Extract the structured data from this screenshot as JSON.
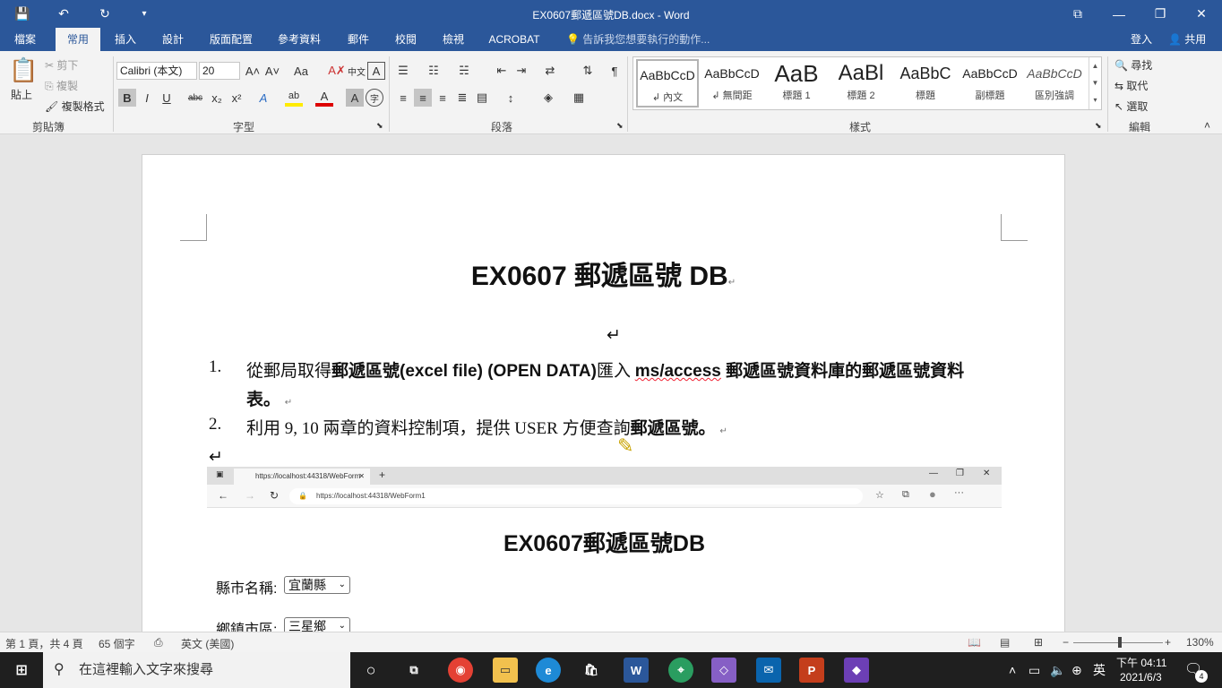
{
  "window": {
    "title": "EX0607郵遞區號DB.docx  -  Word",
    "save_icon": "💾",
    "undo_icon": "↶",
    "redo_icon": "↻",
    "customize_icon": "▾",
    "ribbon_display_icon": "⧉",
    "min_icon": "—",
    "restore_icon": "❐",
    "close_icon": "✕"
  },
  "tabs": [
    "檔案",
    "常用",
    "插入",
    "設計",
    "版面配置",
    "參考資料",
    "郵件",
    "校閱",
    "檢視",
    "ACROBAT"
  ],
  "tell_me": "告訴我您想要執行的動作...",
  "signin": "登入",
  "share": "共用",
  "ribbon": {
    "clipboard": {
      "paste": "貼上",
      "cut": "剪下",
      "copy": "複製",
      "format_painter": "複製格式",
      "label": "剪貼簿"
    },
    "font": {
      "name": "Calibri (本文)",
      "size": "20",
      "label": "字型",
      "bold": "B",
      "italic": "I",
      "underline": "U",
      "strike": "abc",
      "sub": "x₂",
      "sup": "x²",
      "grow": "A˄",
      "shrink": "A˅",
      "case": "Aa",
      "clear": "A✗",
      "phonetic": "中文",
      "border": "A",
      "effects": "A",
      "highlight": "ab",
      "color": "A",
      "shade": "A",
      "enclose": "字"
    },
    "paragraph": {
      "label": "段落"
    },
    "styles": {
      "label": "樣式",
      "items": [
        {
          "preview": "AaBbCcD",
          "name": "↲ 內文"
        },
        {
          "preview": "AaBbCcD",
          "name": "↲ 無間距"
        },
        {
          "preview": "AaB",
          "name": "標題 1"
        },
        {
          "preview": "AaBl",
          "name": "標題 2"
        },
        {
          "preview": "AaBbC",
          "name": "標題"
        },
        {
          "preview": "AaBbCcD",
          "name": "副標題"
        },
        {
          "preview": "AaBbCcD",
          "name": "區別強調"
        }
      ]
    },
    "editing": {
      "find": "尋找",
      "replace": "取代",
      "select": "選取",
      "label": "編輯"
    }
  },
  "document": {
    "title": "EX0607 郵遞區號 DB",
    "para_mark": "↵",
    "list": [
      {
        "num": "1.",
        "pre": "從郵局取得",
        "bold": "郵遞區號(excel file) (OPEN DATA)",
        "mid": "匯入 ",
        "bold2": "ms/access",
        "bold3": "  郵遞區號資料庫的郵遞區號資料",
        "cont": "表。"
      },
      {
        "num": "2.",
        "pre": "利用  9, 10  兩章的資料控制項，提供  USER  方便查詢",
        "bold": "郵遞區號",
        "end": "。"
      }
    ],
    "browser": {
      "tab_title": "https://localhost:44318/WebForm",
      "url": "https://localhost:44318/WebForm1",
      "heading": "EX0607郵遞區號DB",
      "county_label": "縣市名稱:",
      "county_value": "宜蘭縣",
      "town_label": "鄉鎮市區:",
      "town_value": "三星鄉"
    }
  },
  "status": {
    "page": "第 1 頁，共 4 頁",
    "words": "65 個字",
    "lang": "英文 (美國)",
    "zoom": "130%"
  },
  "taskbar": {
    "search": "在這裡輸入文字來搜尋",
    "ime": "英",
    "time": "下午 04:11",
    "date": "2021/6/3",
    "notif": "4"
  }
}
